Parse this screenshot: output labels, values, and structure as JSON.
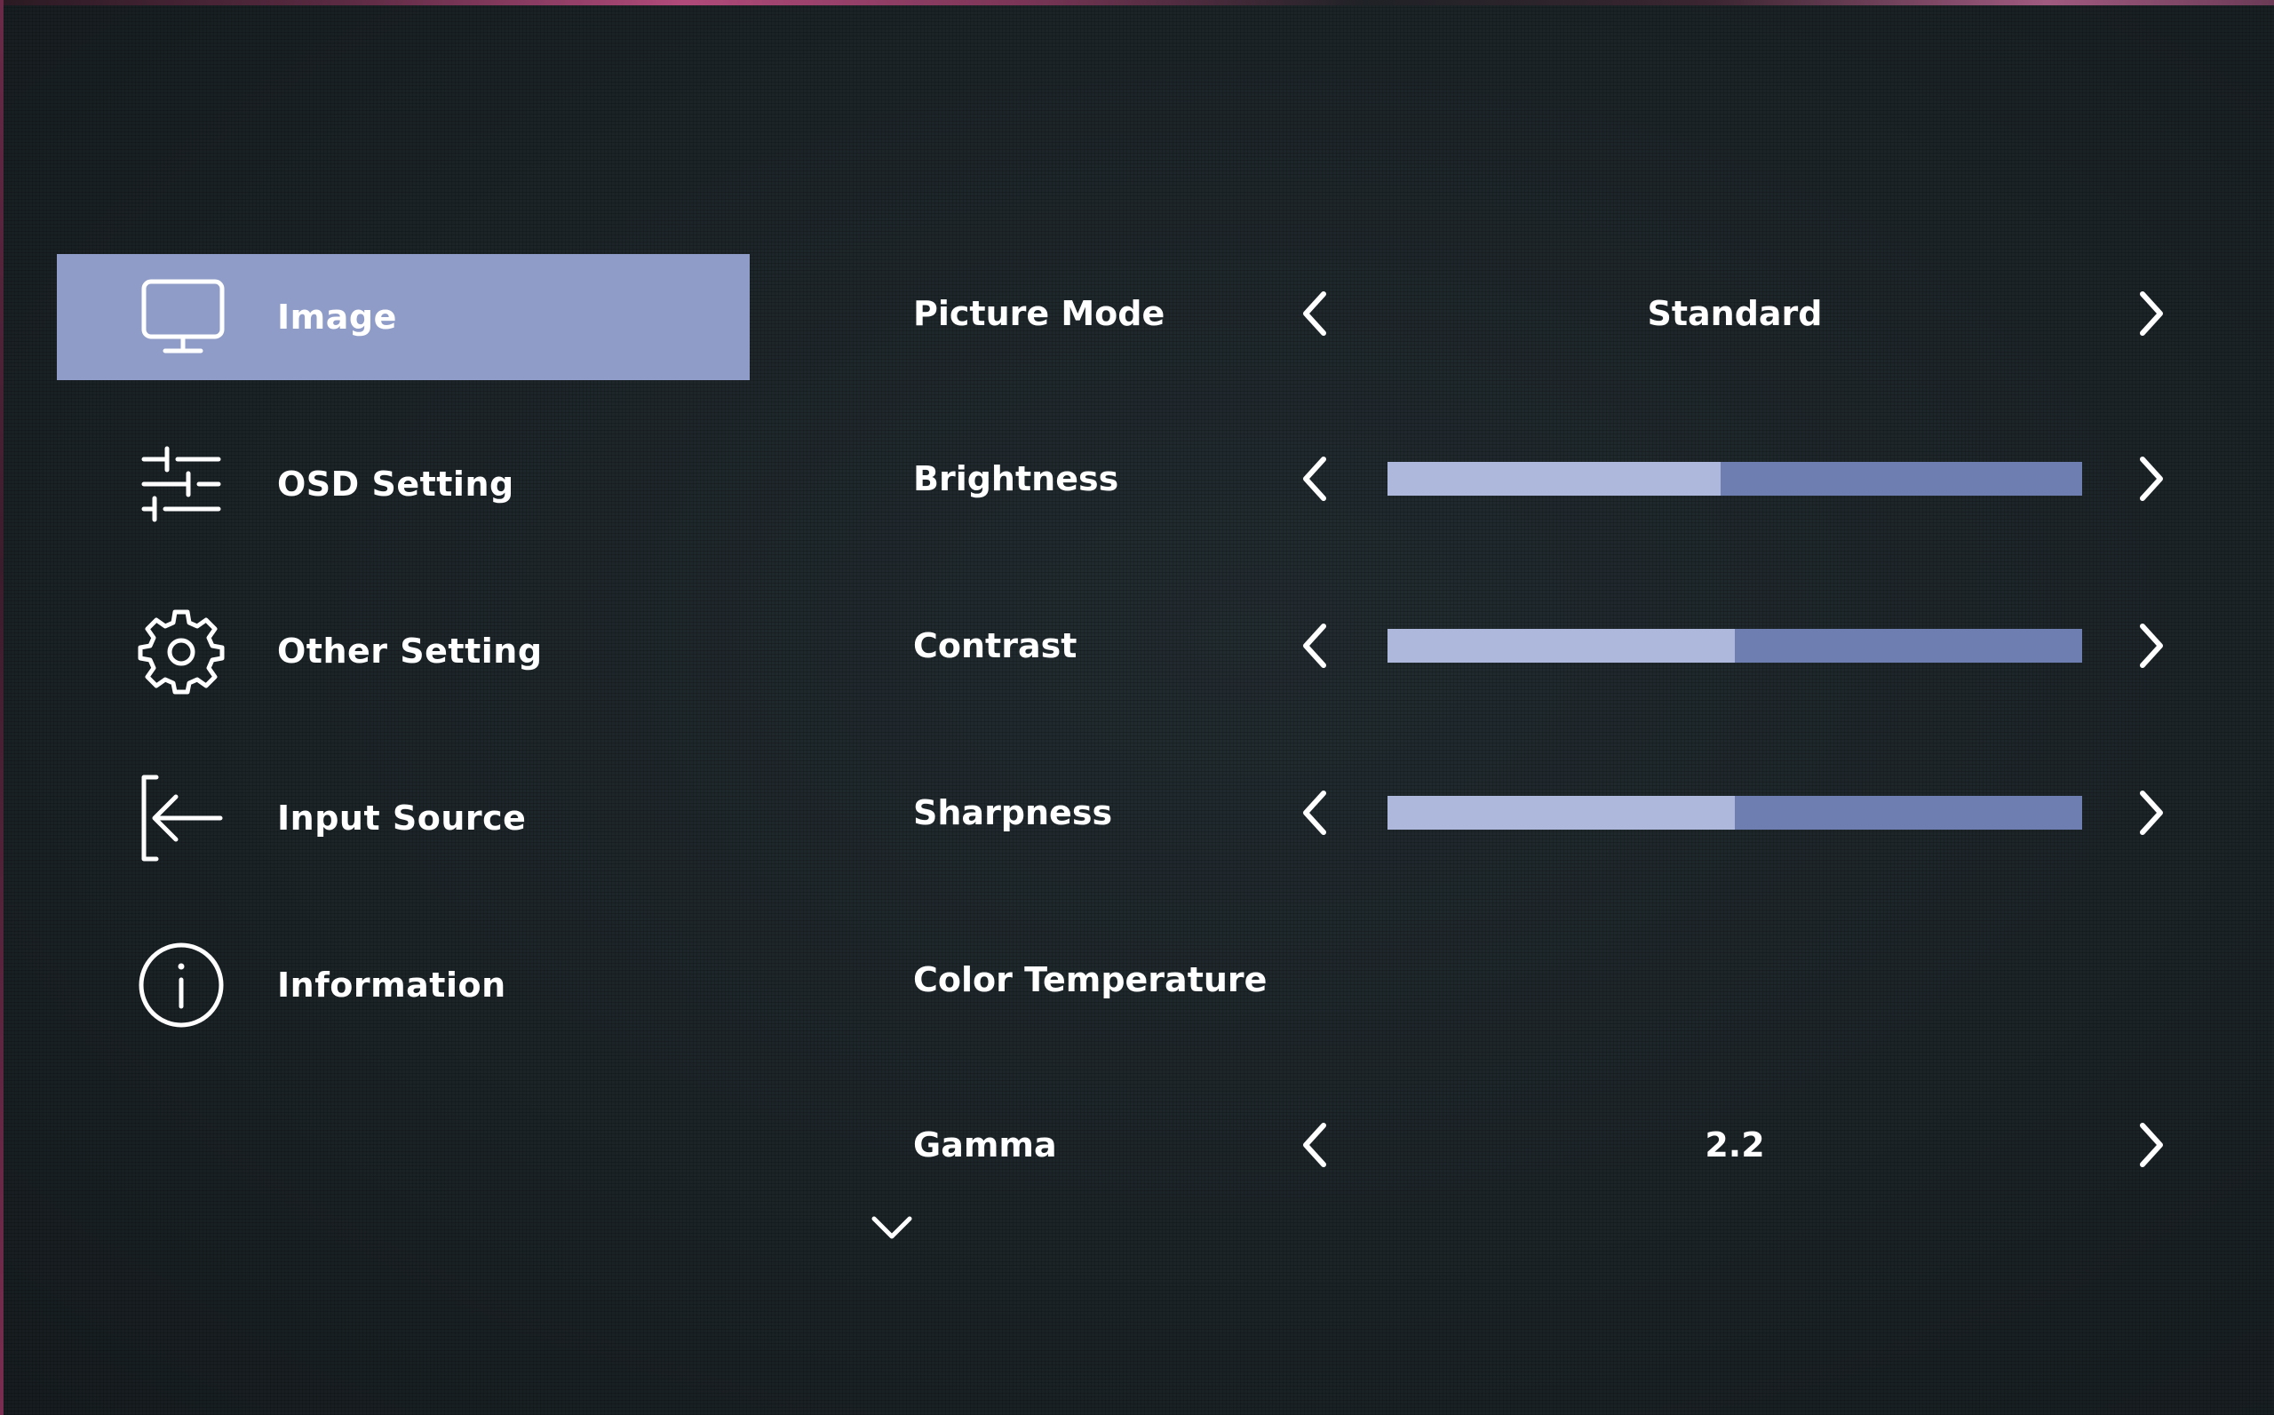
{
  "menu": {
    "items": [
      {
        "label": "Image",
        "icon": "monitor-icon",
        "active": true
      },
      {
        "label": "OSD Setting",
        "icon": "sliders-icon",
        "active": false
      },
      {
        "label": "Other Setting",
        "icon": "gear-icon",
        "active": false
      },
      {
        "label": "Input Source",
        "icon": "input-source-icon",
        "active": false
      },
      {
        "label": "Information",
        "icon": "info-icon",
        "active": false
      }
    ]
  },
  "settings": {
    "picture_mode": {
      "label": "Picture Mode",
      "value": "Standard"
    },
    "brightness": {
      "label": "Brightness",
      "level": 0.48
    },
    "contrast": {
      "label": "Contrast",
      "level": 0.5
    },
    "sharpness": {
      "label": "Sharpness",
      "level": 0.5
    },
    "color_temperature": {
      "label": "Color Temperature"
    },
    "gamma": {
      "label": "Gamma",
      "value": "2.2"
    }
  },
  "icons": {
    "left_arrow": "chevron-left-icon",
    "right_arrow": "chevron-right-icon",
    "scroll": "chevron-down-icon"
  },
  "colors": {
    "background": "#1c2428",
    "active_highlight": "#8f9cc7",
    "bar_track": "#6f7eb0",
    "bar_fill": "#aeb8dc",
    "text": "#ffffff"
  }
}
